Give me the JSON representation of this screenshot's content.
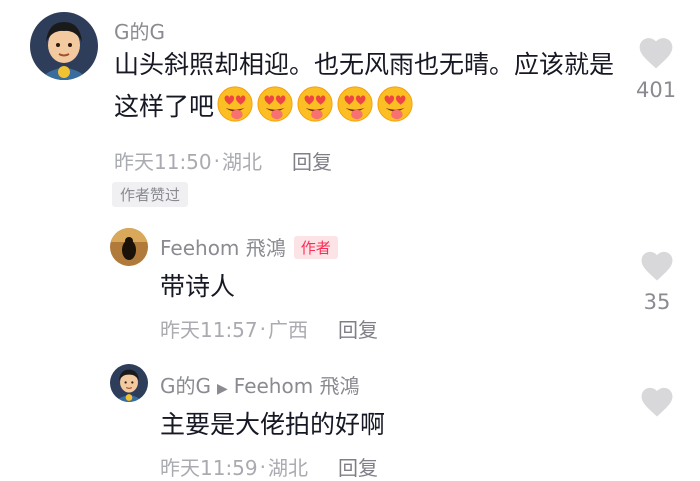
{
  "comments": [
    {
      "username": "G的G",
      "text": "山头斜照却相迎。也无风雨也无晴。应该就是这样了吧",
      "emoji_name": "heart-eyes-tongue-emoji",
      "emoji_count": 5,
      "time": "昨天11:50",
      "location": "湖北",
      "reply_label": "回复",
      "badge": "作者赞过",
      "likes": "401",
      "like_icon": "heart-icon"
    },
    {
      "username": "Feehom 飛鴻",
      "author_tag": "作者",
      "text": "带诗人",
      "time": "昨天11:57",
      "location": "广西",
      "reply_label": "回复",
      "likes": "35",
      "like_icon": "heart-icon"
    },
    {
      "username": "G的G",
      "reply_to": "Feehom 飛鴻",
      "reply_arrow": "▶",
      "text": "主要是大佬拍的好啊",
      "time": "昨天11:59",
      "location": "湖北",
      "reply_label": "回复",
      "like_icon": "heart-icon"
    }
  ],
  "separator": "·",
  "colors": {
    "accent": "#fe2c55",
    "secondary_text": "#8a8b91",
    "meta_text": "#a9abb0",
    "heart": "#d8d8db"
  }
}
